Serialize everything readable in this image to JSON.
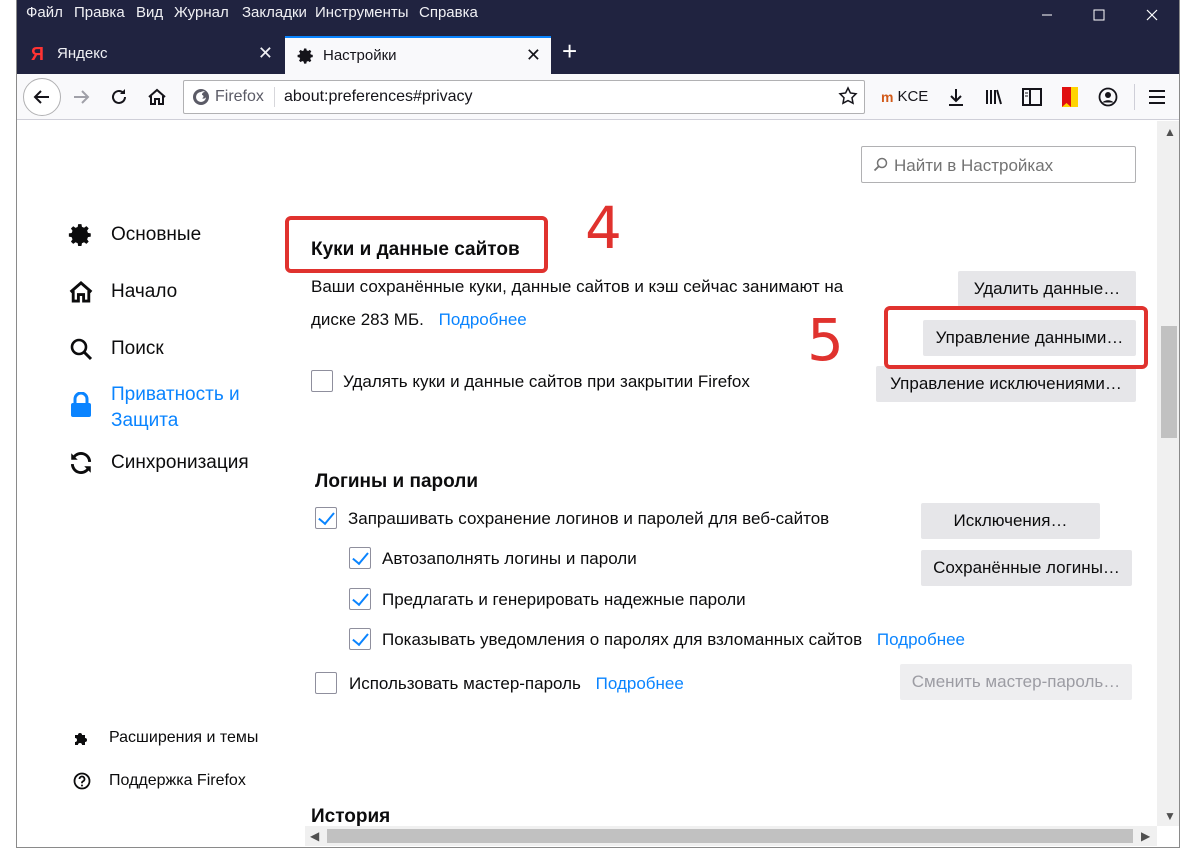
{
  "menu": [
    "Файл",
    "Правка",
    "Вид",
    "Журнал",
    "Закладки",
    "Инструменты",
    "Справка"
  ],
  "tabs": [
    {
      "title": "Яндекс",
      "favicon": "Я",
      "active": false
    },
    {
      "title": "Настройки",
      "favicon": "gear",
      "active": true
    }
  ],
  "nav": {
    "identity_label": "Firefox",
    "url": "about:preferences#privacy",
    "extension_label": "KCE"
  },
  "search": {
    "placeholder": "Найти в Настройках"
  },
  "sidebar": {
    "categories": [
      {
        "label": "Основные",
        "icon": "gear-icon"
      },
      {
        "label": "Начало",
        "icon": "home-icon"
      },
      {
        "label": "Поиск",
        "icon": "search-icon"
      },
      {
        "label": "Приватность и Защита",
        "label_line1": "Приватность и",
        "label_line2": "Защита",
        "icon": "lock-icon",
        "selected": true
      },
      {
        "label": "Синхронизация",
        "icon": "sync-icon"
      }
    ],
    "footer": [
      {
        "label": "Расширения и темы",
        "icon": "puzzle-icon"
      },
      {
        "label": "Поддержка Firefox",
        "icon": "help-icon"
      }
    ]
  },
  "cookies": {
    "heading": "Куки и данные сайтов",
    "description_line1": "Ваши сохранённые куки, данные сайтов и кэш сейчас занимают на",
    "description_line2": "диске 283 МБ.",
    "learn_more": "Подробнее",
    "delete_on_close": "Удалять куки и данные сайтов при закрытии Firefox",
    "buttons": {
      "clear": "Удалить данные…",
      "manage_data": "Управление данными…",
      "manage_exceptions": "Управление исключениями…"
    }
  },
  "logins": {
    "heading": "Логины и пароли",
    "ask_save": "Запрашивать сохранение логинов и паролей для веб-сайтов",
    "autofill": "Автозаполнять логины и пароли",
    "suggest": "Предлагать и генерировать надежные пароли",
    "breach": "Показывать уведомления о паролях для взломанных сайтов",
    "breach_learn_more": "Подробнее",
    "master": "Использовать мастер-пароль",
    "master_learn_more": "Подробнее",
    "buttons": {
      "exceptions": "Исключения…",
      "saved_logins": "Сохранённые логины…",
      "change_master": "Сменить мастер-пароль…"
    }
  },
  "history": {
    "heading": "История"
  },
  "annotations": {
    "step4": "4",
    "step5": "5"
  },
  "colors": {
    "accent": "#0a84ff",
    "annotation": "#e0322e",
    "titlebar": "#202340"
  }
}
